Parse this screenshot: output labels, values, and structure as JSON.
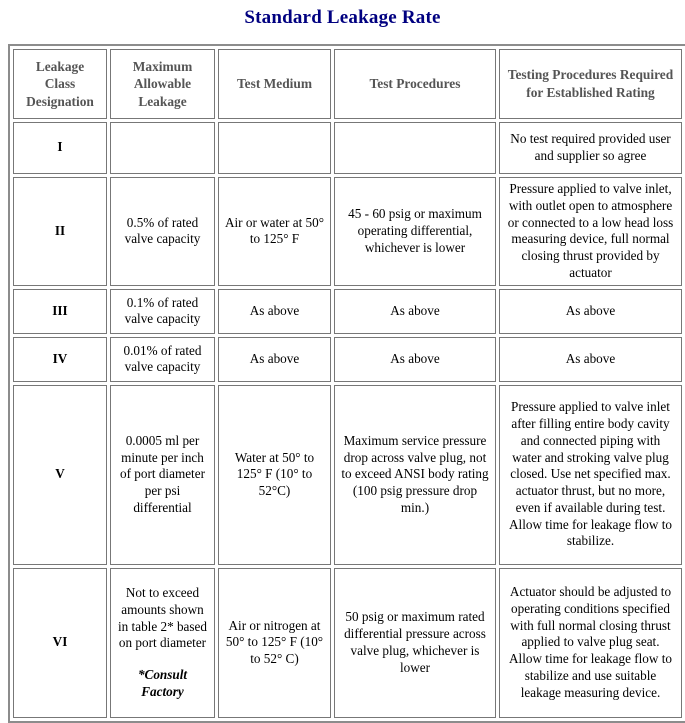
{
  "document": {
    "title": "Standard Leakage Rate",
    "title_color": "#000080"
  },
  "table": {
    "headers": [
      "Leakage Class Designation",
      "Maximum Allowable Leakage",
      "Test Medium",
      "Test Procedures",
      "Testing Procedures Required for Established Rating"
    ],
    "header_color": "#555555",
    "border_color": "#777777",
    "rows": [
      {
        "class": "I",
        "max_leakage": "",
        "test_medium": "",
        "test_procedures": "",
        "testing_required": "No test required provided user and supplier so agree"
      },
      {
        "class": "II",
        "max_leakage": "0.5% of rated valve capacity",
        "test_medium": "Air or water at 50° to 125° F",
        "test_procedures": "45 - 60 psig or maximum operating differential, whichever is lower",
        "testing_required": "Pressure applied to valve inlet, with outlet open to atmosphere or connected to a low head loss measuring device, full normal closing thrust provided by actuator"
      },
      {
        "class": "III",
        "max_leakage": "0.1% of rated valve capacity",
        "test_medium": "As above",
        "test_procedures": "As above",
        "testing_required": "As above"
      },
      {
        "class": "IV",
        "max_leakage": "0.01% of rated valve capacity",
        "test_medium": "As above",
        "test_procedures": "As above",
        "testing_required": "As above"
      },
      {
        "class": "V",
        "max_leakage": "0.0005 ml per minute per inch of port diameter per psi differential",
        "test_medium": "Water at 50° to 125° F (10° to 52°C)",
        "test_procedures": "Maximum service pressure drop across valve plug, not to exceed ANSI body rating (100 psig pressure drop min.)",
        "testing_required": "Pressure applied to valve inlet after filling entire body cavity and connected piping with water and stroking valve plug closed. Use net specified max. actuator thrust, but no more, even if available during test. Allow time for leakage flow to stabilize."
      },
      {
        "class": "VI",
        "max_leakage": "Not to exceed amounts shown in table 2* based on port diameter",
        "max_leakage_note": "*Consult Factory",
        "test_medium": "Air or nitrogen at 50° to 125° F (10° to 52° C)",
        "test_procedures": "50 psig or maximum rated differential pressure across valve plug, whichever is lower",
        "testing_required": "Actuator should be adjusted to operating conditions specified with full normal closing thrust applied to valve plug seat. Allow time for leakage flow to stabilize and use suitable leakage measuring device."
      }
    ]
  }
}
